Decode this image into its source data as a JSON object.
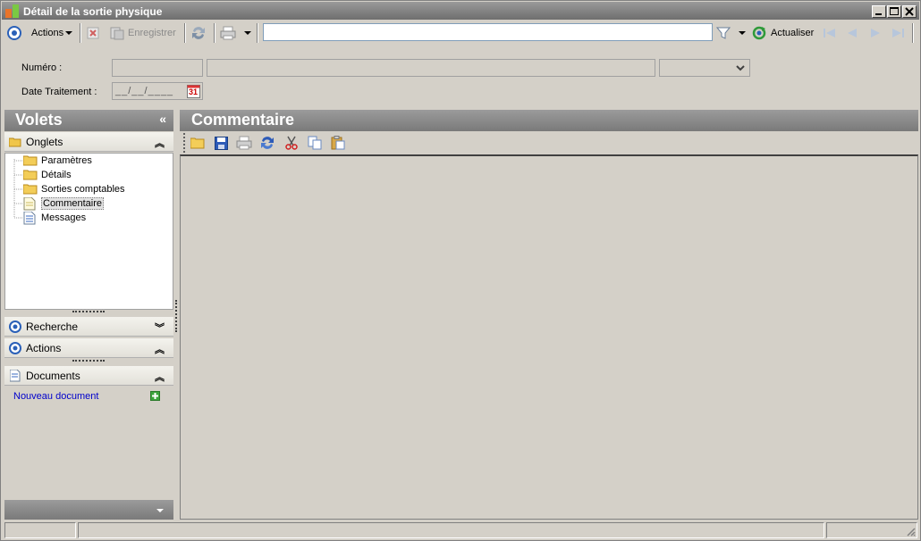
{
  "window": {
    "title": "Détail de la sortie physique"
  },
  "toolbar": {
    "actions_label": "Actions",
    "save_label": "Enregistrer",
    "refresh_label": "Actualiser",
    "search_value": ""
  },
  "form": {
    "numero_label": "Numéro :",
    "date_label": "Date Traitement :",
    "date_placeholder": "__/__/____",
    "calendar_day": "31"
  },
  "sidebar": {
    "title": "Volets",
    "collapse_glyph": "«",
    "onglets": {
      "label": "Onglets",
      "items": [
        {
          "label": "Paramètres",
          "icon": "folder-icon"
        },
        {
          "label": "Détails",
          "icon": "folder-icon"
        },
        {
          "label": "Sorties comptables",
          "icon": "folder-icon"
        },
        {
          "label": "Commentaire",
          "icon": "document-icon",
          "selected": true
        },
        {
          "label": "Messages",
          "icon": "document-lines-icon"
        }
      ]
    },
    "recherche_label": "Recherche",
    "actions_label": "Actions",
    "documents": {
      "label": "Documents",
      "new_doc_label": "Nouveau document"
    }
  },
  "main": {
    "title": "Commentaire",
    "tools": [
      "open-folder-icon",
      "save-icon",
      "print-icon",
      "refresh-icon",
      "cut-icon",
      "copy-icon",
      "paste-icon"
    ]
  },
  "colors": {
    "header_bg": "#808080",
    "panel_bg": "#d4d0c8",
    "link": "#0000cc",
    "accent_blue": "#1f5fbf"
  }
}
